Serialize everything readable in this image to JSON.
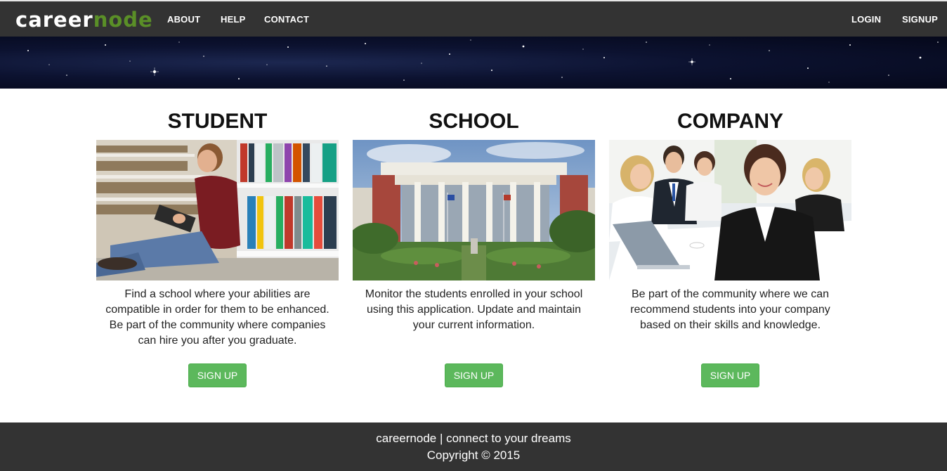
{
  "nav": {
    "brand_part1": "career",
    "brand_part2": "node",
    "about": "ABOUT",
    "help": "HELP",
    "contact": "CONTACT",
    "login": "LOGIN",
    "signup": "SIGNUP"
  },
  "cards": [
    {
      "title": "STUDENT",
      "text": "Find a school where your abilities are compatible in order for them to be enhanced. Be part of the community where companies can hire you after you graduate.",
      "button": "SIGN UP"
    },
    {
      "title": "SCHOOL",
      "text": "Monitor the students enrolled in your school using this application. Update and maintain your current information.",
      "button": "SIGN UP"
    },
    {
      "title": "COMPANY",
      "text": "Be part of the community where we can recommend students into your company based on their skills and knowledge.",
      "button": "SIGN UP"
    }
  ],
  "footer": {
    "tagline": "careernode | connect to your dreams",
    "copyright": "Copyright © 2015"
  },
  "colors": {
    "navbar": "#333333",
    "button": "#5cb85c",
    "brand_accent": "#5a8f27"
  }
}
